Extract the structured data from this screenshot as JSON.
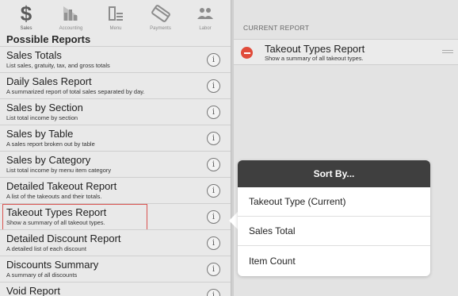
{
  "categories": [
    {
      "label": "Sales",
      "icon": "dollar-icon"
    },
    {
      "label": "Accounting",
      "icon": "accounting-icon"
    },
    {
      "label": "Menu",
      "icon": "menu-icon"
    },
    {
      "label": "Payments",
      "icon": "payments-icon"
    },
    {
      "label": "Labor",
      "icon": "labor-icon"
    }
  ],
  "section_title": "Possible Reports",
  "reports": [
    {
      "title": "Sales Totals",
      "desc": "List sales, gratuity, tax, and gross totals"
    },
    {
      "title": "Daily Sales Report",
      "desc": "A summarized report of total sales separated by day."
    },
    {
      "title": "Sales by Section",
      "desc": "List total income by section"
    },
    {
      "title": "Sales by Table",
      "desc": "A sales report broken out by table"
    },
    {
      "title": "Sales by Category",
      "desc": "List total income by menu item category"
    },
    {
      "title": "Detailed Takeout Report",
      "desc": "A list of the takeouts and their totals."
    },
    {
      "title": "Takeout Types Report",
      "desc": "Show a summary of all takeout types."
    },
    {
      "title": "Detailed Discount Report",
      "desc": "A detailed list of each discount"
    },
    {
      "title": "Discounts Summary",
      "desc": "A summary of all discounts"
    },
    {
      "title": "Void Report",
      "desc": ""
    }
  ],
  "info_glyph": "i",
  "current_report": {
    "label": "CURRENT REPORT",
    "title": "Takeout Types Report",
    "desc": "Show a summary of all takeout types."
  },
  "sort_popover": {
    "title": "Sort By...",
    "options": [
      "Takeout Type (Current)",
      "Sales Total",
      "Item Count"
    ]
  },
  "colors": {
    "remove": "#e04b3a",
    "highlight": "#d9534f",
    "popover_header": "#3f3f3f"
  }
}
